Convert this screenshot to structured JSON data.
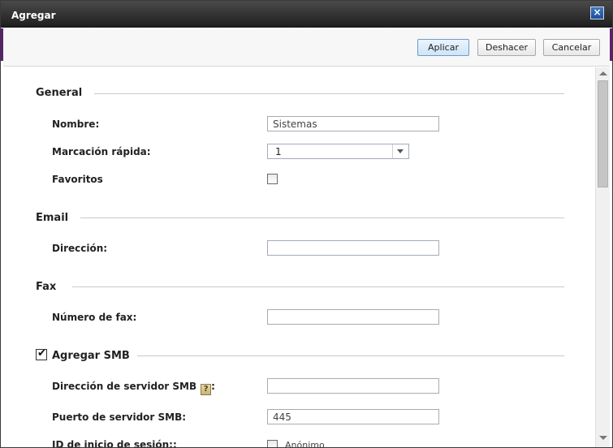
{
  "dialog": {
    "title": "Agregar",
    "close_glyph": "×"
  },
  "toolbar": {
    "apply_label": "Aplicar",
    "undo_label": "Deshacer",
    "cancel_label": "Cancelar"
  },
  "general": {
    "title": "General",
    "name_label": "Nombre:",
    "name_value": "Sistemas",
    "speed_dial_label": "Marcación rápida:",
    "speed_dial_value": "1",
    "favorites_label": "Favoritos",
    "favorites_checked": false
  },
  "email": {
    "title": "Email",
    "address_label": "Dirección:",
    "address_value": ""
  },
  "fax": {
    "title": "Fax",
    "number_label": "Número de fax:",
    "number_value": ""
  },
  "smb": {
    "title": "Agregar SMB",
    "checked": true,
    "checkmark": "✔",
    "server_label": "Dirección de servidor SMB",
    "server_label_suffix": ":",
    "help_glyph": "?",
    "server_value": "",
    "port_label": "Puerto de servidor SMB:",
    "port_value": "445",
    "login_label": "ID de inicio de sesión::",
    "anonymous_label": "Anónimo"
  },
  "icons": {
    "close": "close-icon",
    "dropdown": "chevron-down-icon",
    "help": "help-icon",
    "check": "checkmark-icon"
  },
  "colors": {
    "titlebar": "#2b2b2b",
    "accent": "#5e1f72",
    "apply_button": "#cfe4f7"
  }
}
